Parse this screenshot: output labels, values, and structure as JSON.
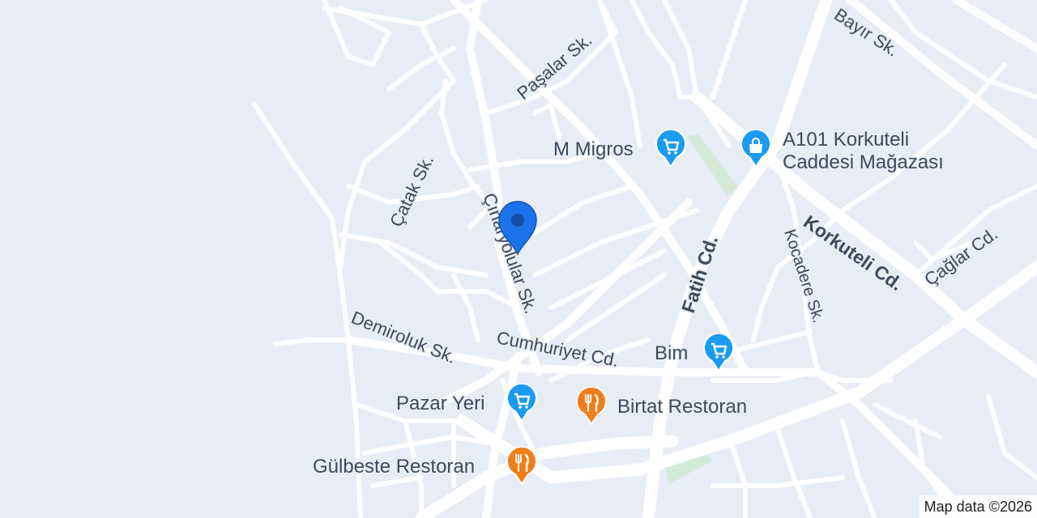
{
  "streets": {
    "pasalar": "Paşalar Sk.",
    "bayir": "Bayır Sk.",
    "catak": "Çatak Sk.",
    "cinaryolular": "Çınaryolular Sk.",
    "korkuteli": "Korkuteli Cd.",
    "caglar": "Çağlar Cd.",
    "fatih": "Fatih Cd.",
    "kocadere": "Kocadere Sk.",
    "demiroluk": "Demiroluk Sk.",
    "cumhuriyet": "Cumhuriyet Cd."
  },
  "pois": {
    "migros": {
      "name": "M Migros",
      "icon": "shopping-cart-icon",
      "color": "#1a9bf0"
    },
    "a101": {
      "line1": "A101 Korkuteli",
      "line2": "Caddesi Mağazası",
      "icon": "shopping-bag-icon",
      "color": "#1a9bf0"
    },
    "bim": {
      "name": "Bim",
      "icon": "shopping-cart-icon",
      "color": "#1a9bf0"
    },
    "pazar": {
      "name": "Pazar Yeri",
      "icon": "shopping-cart-icon",
      "color": "#1a9bf0"
    },
    "birtat": {
      "name": "Birtat Restoran",
      "icon": "restaurant-icon",
      "color": "#f07d1a"
    },
    "gulbeste": {
      "name": "Gülbeste Restoran",
      "icon": "restaurant-icon",
      "color": "#f07d1a"
    }
  },
  "location_marker": {
    "icon": "location-pin-icon",
    "color": "#1a73e8"
  },
  "park_color": "#d4ebd9",
  "attribution": "Map data ©2026"
}
